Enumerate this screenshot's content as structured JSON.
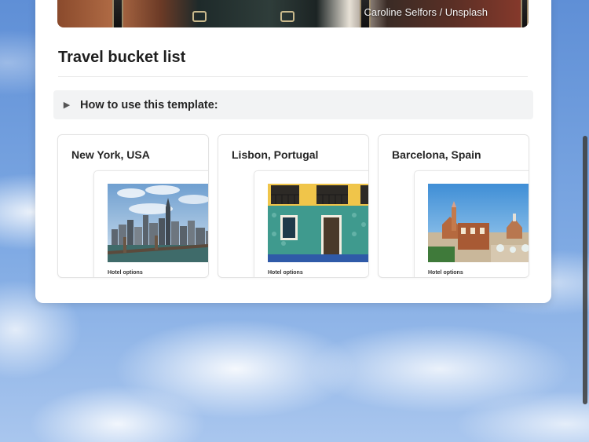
{
  "cover": {
    "credit": "Caroline Selfors / Unsplash"
  },
  "page": {
    "title": "Travel bucket list"
  },
  "toggle": {
    "icon": "triangle-right-icon",
    "label": "How to use this template:"
  },
  "gallery": [
    {
      "title": "New York, USA",
      "preview_label": "Hotel options",
      "photo": "new-york-skyline"
    },
    {
      "title": "Lisbon, Portugal",
      "preview_label": "Hotel options",
      "photo": "lisbon-building"
    },
    {
      "title": "Barcelona, Spain",
      "preview_label": "Hotel options",
      "photo": "barcelona-park-guell"
    }
  ],
  "colors": {
    "sky": "#7aa6df",
    "card_bg": "#ffffff",
    "toggle_bg": "#f2f3f4",
    "text": "#1f1f1f"
  }
}
